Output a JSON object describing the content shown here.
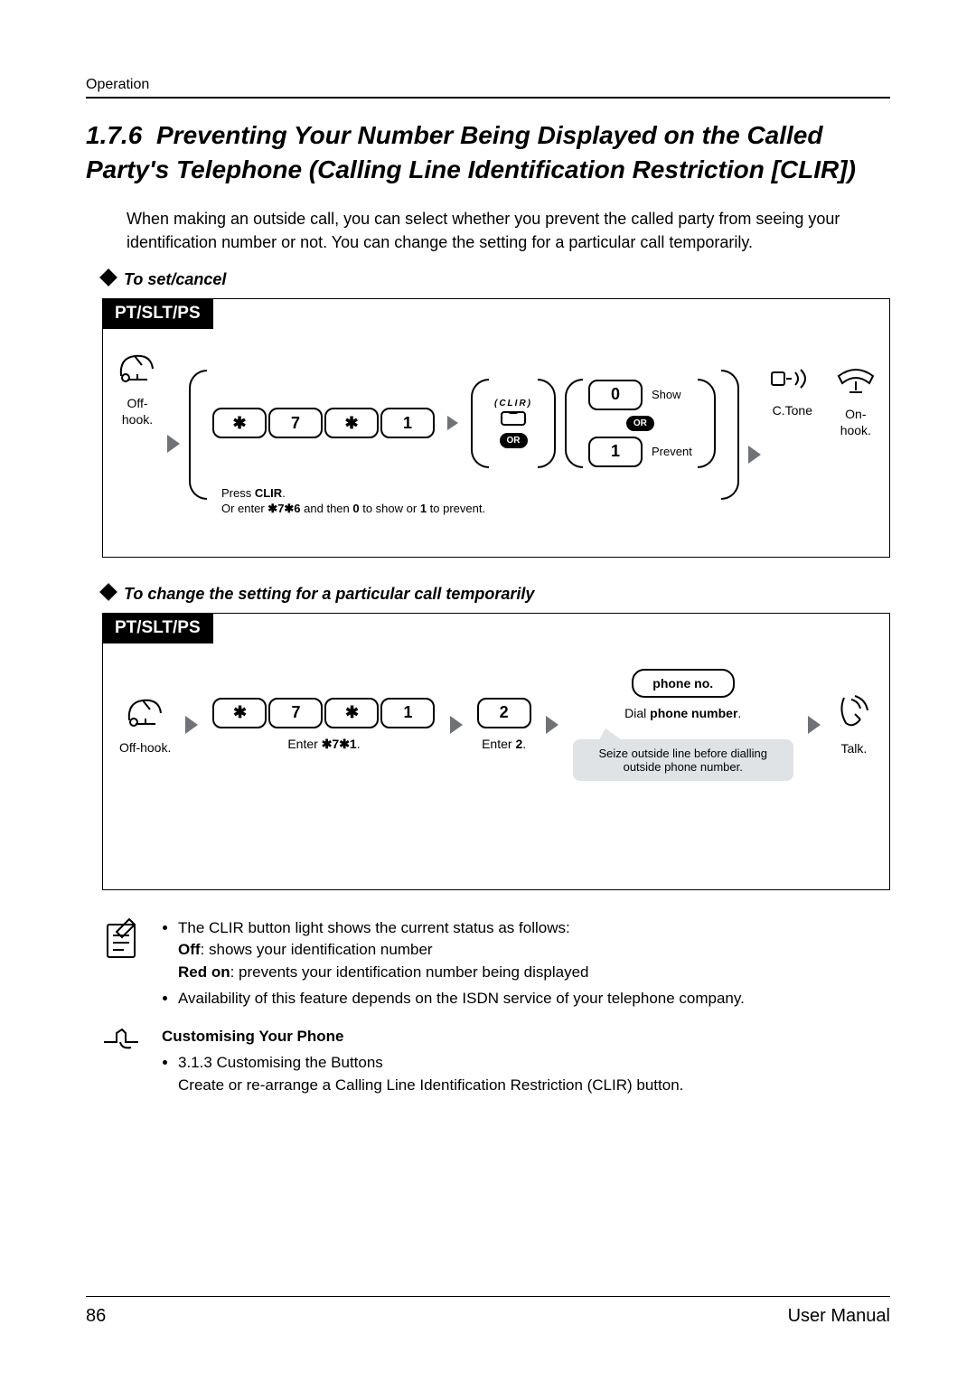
{
  "header": {
    "section": "Operation"
  },
  "title": {
    "number": "1.7.6",
    "text": "Preventing Your Number Being Displayed on the Called Party's Telephone (Calling Line Identification Restriction [CLIR])"
  },
  "intro": "When making an outside call, you can select whether you prevent the called party from seeing your identification number or not. You can change the setting for a particular call temporarily.",
  "subhead1": "To set/cancel",
  "flow1": {
    "tab": "PT/SLT/PS",
    "offhook": "Off-hook.",
    "keys": {
      "star": "✱",
      "k7": "7",
      "k1": "1"
    },
    "clir_label": "(CLIR)",
    "or": "OR",
    "opt0": "0",
    "opt0_lbl": "Show",
    "opt1": "1",
    "opt1_lbl": "Prevent",
    "ctone": "C.Tone",
    "onhook": "On-hook.",
    "cap_line1": "Press ",
    "cap_bold1": "CLIR",
    "cap_line1b": ".",
    "cap_line2a": "Or enter ",
    "cap_bold2": "✱7✱6",
    "cap_line2b": " and then ",
    "cap_bold3": "0",
    "cap_line2c": " to show or ",
    "cap_bold4": "1",
    "cap_line2d": " to prevent."
  },
  "subhead2": "To change the setting for a particular call temporarily",
  "flow2": {
    "tab": "PT/SLT/PS",
    "offhook": "Off-hook.",
    "enter71a": "Enter ",
    "enter71b": "✱7✱1",
    "enter71c": ".",
    "k2": "2",
    "enter2a": "Enter ",
    "enter2b": "2",
    "enter2c": ".",
    "phone_no": "phone no.",
    "dial_a": "Dial ",
    "dial_b": "phone number",
    "dial_c": ".",
    "talk": "Talk.",
    "callout": "Seize outside line before dialling outside phone number."
  },
  "notes": {
    "li1a": "The CLIR button light shows the current status as follows:",
    "li1_off_b": "Off",
    "li1_off_t": ": shows your identification number",
    "li1_red_b": "Red on",
    "li1_red_t": ": prevents your identification number being displayed",
    "li2": "Availability of this feature depends on the ISDN service of your telephone company."
  },
  "custom": {
    "title": "Customising Your Phone",
    "ref": "3.1.3   Customising the Buttons",
    "desc": "Create or re-arrange a Calling Line Identification Restriction (CLIR) button."
  },
  "footer": {
    "page": "86",
    "doc": "User Manual"
  }
}
